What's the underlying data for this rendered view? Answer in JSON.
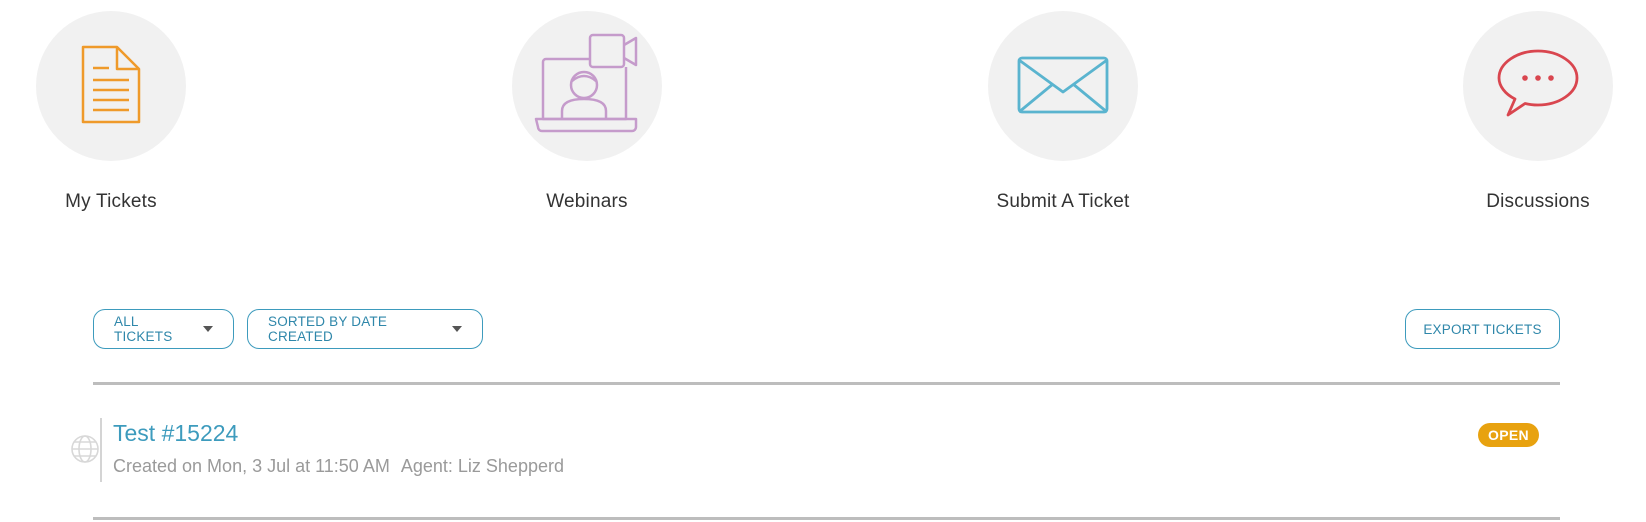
{
  "nav": {
    "tiles": [
      {
        "label": "My Tickets",
        "icon": "document-icon",
        "color": "#ef9a2a"
      },
      {
        "label": "Webinars",
        "icon": "webinar-laptop-icon",
        "color": "#c59bcb"
      },
      {
        "label": "Submit A Ticket",
        "icon": "envelope-icon",
        "color": "#5ab4cf"
      },
      {
        "label": "Discussions",
        "icon": "chat-bubble-icon",
        "color": "#d9464f"
      }
    ]
  },
  "toolbar": {
    "filter_label": "ALL TICKETS",
    "sort_label": "SORTED BY DATE CREATED",
    "export_label": "EXPORT TICKETS"
  },
  "tickets": [
    {
      "title": "Test #15224",
      "created": "Created on Mon, 3 Jul at 11:50 AM",
      "agent": "Agent: Liz Shepperd",
      "status": "OPEN",
      "icon": "globe-icon"
    }
  ],
  "colors": {
    "accent": "#3d9bbd",
    "status_open": "#e8a20f",
    "circle_bg": "#f1f1f1"
  }
}
